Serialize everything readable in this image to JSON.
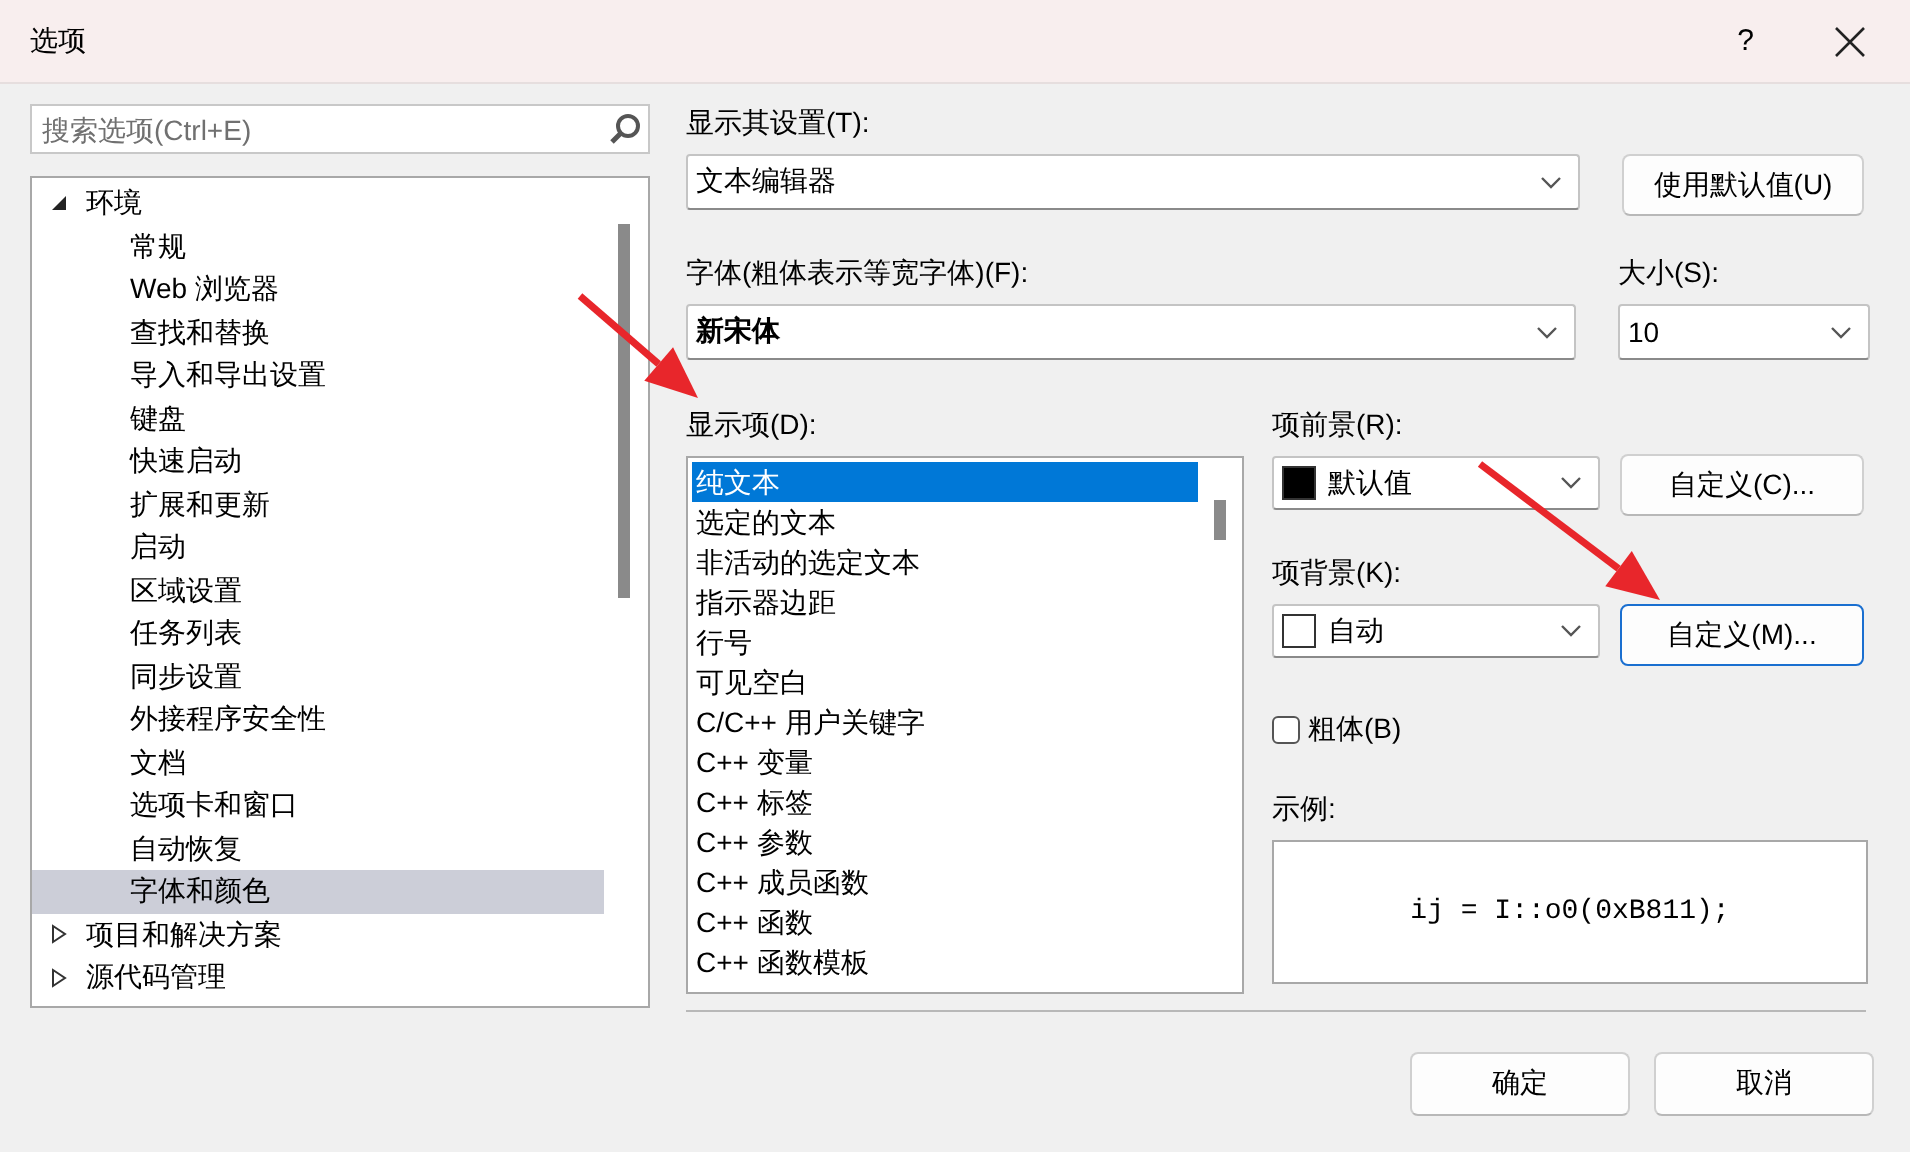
{
  "window": {
    "title": "选项",
    "help": "?"
  },
  "search": {
    "placeholder": "搜索选项(Ctrl+E)"
  },
  "tree": [
    {
      "label": "环境",
      "expanded": true,
      "selected": false,
      "children": [
        {
          "label": "常规",
          "selected": false
        },
        {
          "label": "Web 浏览器",
          "selected": false
        },
        {
          "label": "查找和替换",
          "selected": false
        },
        {
          "label": "导入和导出设置",
          "selected": false
        },
        {
          "label": "键盘",
          "selected": false
        },
        {
          "label": "快速启动",
          "selected": false
        },
        {
          "label": "扩展和更新",
          "selected": false
        },
        {
          "label": "启动",
          "selected": false
        },
        {
          "label": "区域设置",
          "selected": false
        },
        {
          "label": "任务列表",
          "selected": false
        },
        {
          "label": "同步设置",
          "selected": false
        },
        {
          "label": "外接程序安全性",
          "selected": false
        },
        {
          "label": "文档",
          "selected": false
        },
        {
          "label": "选项卡和窗口",
          "selected": false
        },
        {
          "label": "自动恢复",
          "selected": false
        },
        {
          "label": "字体和颜色",
          "selected": true
        }
      ]
    },
    {
      "label": "项目和解决方案",
      "expanded": false,
      "selected": false
    },
    {
      "label": "源代码管理",
      "expanded": false,
      "selected": false
    }
  ],
  "show_settings": {
    "label": "显示其设置(T):",
    "value": "文本编辑器"
  },
  "use_defaults_button": "使用默认值(U)",
  "font": {
    "label": "字体(粗体表示等宽字体)(F):",
    "value": "新宋体"
  },
  "size": {
    "label": "大小(S):",
    "value": "10"
  },
  "display_items": {
    "label": "显示项(D):",
    "items": [
      {
        "label": "纯文本",
        "selected": true
      },
      {
        "label": "选定的文本",
        "selected": false
      },
      {
        "label": "非活动的选定文本",
        "selected": false
      },
      {
        "label": "指示器边距",
        "selected": false
      },
      {
        "label": "行号",
        "selected": false
      },
      {
        "label": "可见空白",
        "selected": false
      },
      {
        "label": "C/C++ 用户关键字",
        "selected": false
      },
      {
        "label": "C++ 变量",
        "selected": false
      },
      {
        "label": "C++ 标签",
        "selected": false
      },
      {
        "label": "C++ 参数",
        "selected": false
      },
      {
        "label": "C++ 成员函数",
        "selected": false
      },
      {
        "label": "C++ 函数",
        "selected": false
      },
      {
        "label": "C++ 函数模板",
        "selected": false
      }
    ]
  },
  "foreground": {
    "label": "项前景(R):",
    "value": "默认值",
    "color": "#000000",
    "button": {
      "label": "自定义(C)...",
      "focused": false
    }
  },
  "background": {
    "label": "项背景(K):",
    "value": "自动",
    "color": "#ffffff",
    "button": {
      "label": "自定义(M)...",
      "focused": true
    }
  },
  "bold": {
    "label": "粗体(B)",
    "checked": false
  },
  "sample": {
    "label": "示例:",
    "text": "ij = I::o0(0xB811);"
  },
  "buttons": [
    {
      "label": "确定"
    },
    {
      "label": "取消"
    }
  ],
  "annotations": [
    {
      "kind": "arrow"
    },
    {
      "kind": "arrow"
    }
  ]
}
